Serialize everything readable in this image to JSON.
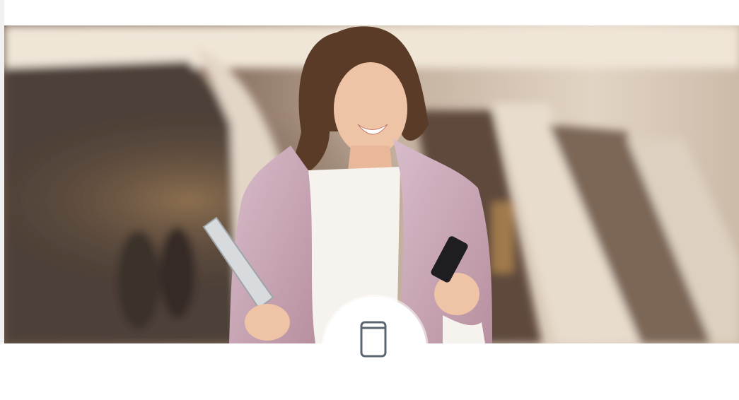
{
  "hero": {
    "image": "woman-smiling-at-smartphone-photo"
  },
  "badge": {
    "icon": "smartphone-icon"
  }
}
